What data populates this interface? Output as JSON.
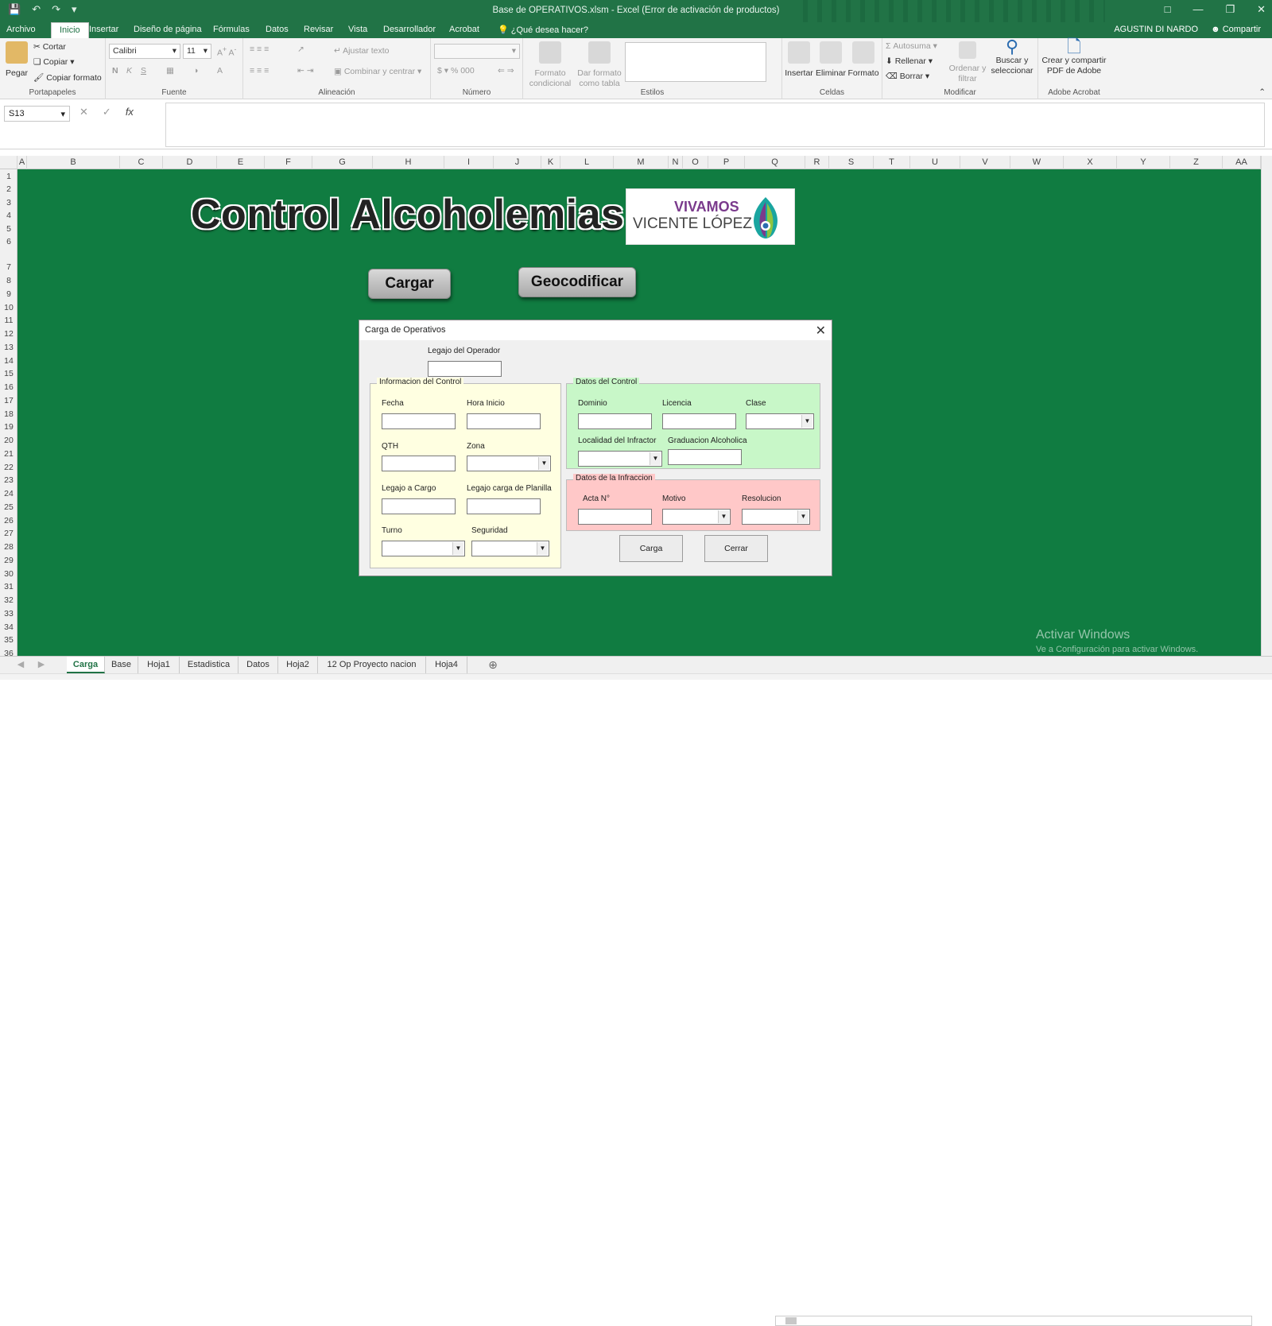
{
  "window": {
    "title": "Base de OPERATIVOS.xlsm - Excel (Error de activación de productos)",
    "user": "AGUSTIN DI NARDO",
    "share": "Compartir"
  },
  "tabs": [
    "Archivo",
    "Inicio",
    "Insertar",
    "Diseño de página",
    "Fórmulas",
    "Datos",
    "Revisar",
    "Vista",
    "Desarrollador",
    "Acrobat"
  ],
  "tell_me": "¿Qué desea hacer?",
  "ribbon": {
    "clipboard": {
      "paste": "Pegar",
      "cut": "Cortar",
      "copy": "Copiar",
      "format_painter": "Copiar formato",
      "label": "Portapapeles"
    },
    "font": {
      "name": "Calibri",
      "size": "11",
      "label": "Fuente"
    },
    "alignment": {
      "wrap": "Ajustar texto",
      "merge": "Combinar y centrar",
      "label": "Alineación"
    },
    "number": {
      "label": "Número",
      "format": ""
    },
    "styles": {
      "conditional": "Formato condicional",
      "as_table": "Dar formato como tabla",
      "label": "Estilos"
    },
    "cells": {
      "insert": "Insertar",
      "delete": "Eliminar",
      "format": "Formato",
      "label": "Celdas"
    },
    "editing": {
      "autosum": "Autosuma",
      "fill": "Rellenar",
      "clear": "Borrar",
      "sort": "Ordenar y filtrar",
      "find": "Buscar y seleccionar",
      "label": "Modificar"
    },
    "acrobat": {
      "create": "Crear y compartir PDF de Adobe",
      "label": "Adobe Acrobat"
    }
  },
  "formula_bar": {
    "name_box": "S13",
    "formula": "",
    "fx": "fx"
  },
  "columns": [
    "A",
    "B",
    "C",
    "D",
    "E",
    "F",
    "G",
    "H",
    "I",
    "J",
    "K",
    "L",
    "M",
    "N",
    "O",
    "P",
    "Q",
    "R",
    "S",
    "T",
    "U",
    "V",
    "W",
    "X",
    "Y",
    "Z",
    "AA"
  ],
  "rows": [
    "1",
    "2",
    "3",
    "4",
    "5",
    "6",
    "7",
    "8",
    "9",
    "10",
    "11",
    "12",
    "13",
    "14",
    "15",
    "16",
    "17",
    "18",
    "19",
    "20",
    "21",
    "22",
    "23",
    "24",
    "25",
    "26",
    "27",
    "28",
    "29",
    "30",
    "31",
    "32",
    "33",
    "34",
    "35",
    "36"
  ],
  "sheet": {
    "title": "Control Alcoholemias",
    "logo_line1": "VIVAMOS",
    "logo_line2": "VICENTE LÓPEZ",
    "btn_cargar": "Cargar",
    "btn_geocodificar": "Geocodificar"
  },
  "dialog": {
    "title": "Carga de Operativos",
    "legajo_operador": "Legajo del Operador",
    "info_frame": "Informacion del Control",
    "fecha": "Fecha",
    "hora_inicio": "Hora Inicio",
    "qth": "QTH",
    "zona": "Zona",
    "legajo_cargo": "Legajo a Cargo",
    "legajo_planilla": "Legajo carga de Planilla",
    "turno": "Turno",
    "seguridad": "Seguridad",
    "datos_frame": "Datos del Control",
    "dominio": "Dominio",
    "licencia": "Licencia",
    "clase": "Clase",
    "localidad": "Localidad del Infractor",
    "graduacion": "Graduacion Alcoholica",
    "infraccion_frame": "Datos de la Infraccion",
    "acta": "Acta N°",
    "motivo": "Motivo",
    "resolucion": "Resolucion",
    "btn_carga": "Carga",
    "btn_cerrar": "Cerrar",
    "colors": {
      "info_bg": "#ffffe1",
      "datos_bg": "#c8f7c8",
      "infraccion_bg": "#ffc8c8"
    }
  },
  "sheet_tabs": [
    "Carga",
    "Base",
    "Hoja1",
    "Estadistica",
    "Datos",
    "Hoja2",
    "12 Op Proyecto nacion",
    "Hoja4"
  ],
  "watermark": {
    "line1": "Activar Windows",
    "line2": "Ve a Configuración para activar Windows."
  },
  "colors": {
    "excel_green": "#217346",
    "sheet_bg": "#107c41"
  }
}
